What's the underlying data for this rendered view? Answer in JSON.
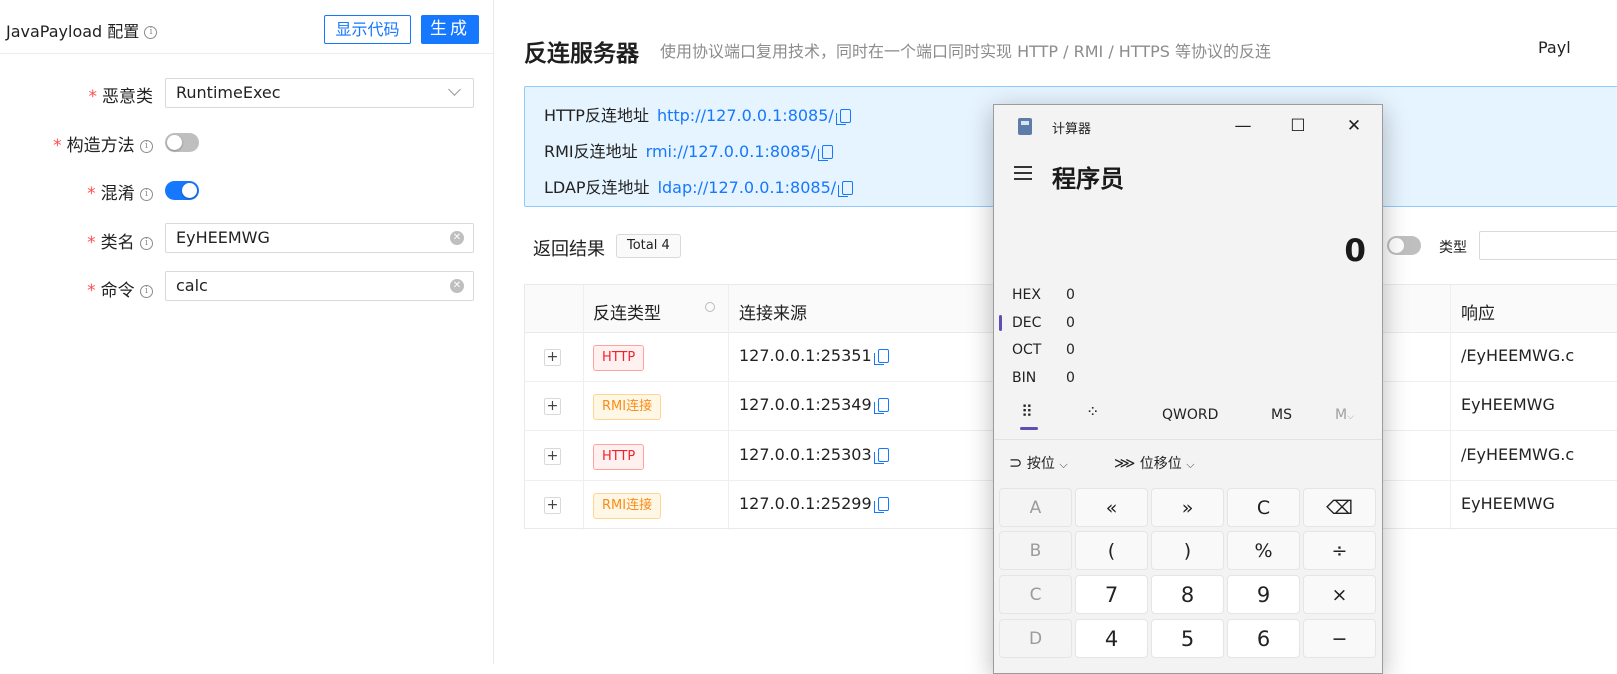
{
  "left_panel": {
    "title": "JavaPayload 配置",
    "btn_show_code": "显示代码",
    "btn_generate": "生成",
    "fields": {
      "malicious_class": {
        "label": "恶意类",
        "value": "RuntimeExec"
      },
      "constructor": {
        "label": "构造方法",
        "on": false
      },
      "obfuscate": {
        "label": "混淆",
        "on": true
      },
      "class_name": {
        "label": "类名",
        "value": "EyHEEMWG"
      },
      "command": {
        "label": "命令",
        "value": "calc"
      }
    }
  },
  "main": {
    "title": "反连服务器",
    "desc": "使用协议端口复用技术，同时在一个端口同时实现 HTTP / RMI / HTTPS 等协议的反连",
    "top_right": "Payl"
  },
  "alert": {
    "http_label": "HTTP反连地址",
    "http_url": "http://127.0.0.1:8085/",
    "rmi_label": "RMI反连地址",
    "rmi_url": "rmi://127.0.0.1:8085/",
    "ldap_label": "LDAP反连地址",
    "ldap_url": "ldap://127.0.0.1:8085/"
  },
  "results": {
    "title": "返回结果",
    "total": "Total 4",
    "type_label": "类型",
    "columns": {
      "type": "反连类型",
      "source": "连接来源",
      "response": "响应"
    },
    "rows": [
      {
        "type": "HTTP",
        "source": "127.0.0.1:25351",
        "response": "/EyHEEMWG.c"
      },
      {
        "type": "RMI连接",
        "source": "127.0.0.1:25349",
        "response": "EyHEEMWG"
      },
      {
        "type": "HTTP",
        "source": "127.0.0.1:25303",
        "response": "/EyHEEMWG.c"
      },
      {
        "type": "RMI连接",
        "source": "127.0.0.1:25299",
        "response": "EyHEEMWG"
      }
    ]
  },
  "calculator": {
    "window_title": "计算器",
    "mode": "程序员",
    "display": "0",
    "hex_label": "HEX",
    "hex_value": "0",
    "dec_label": "DEC",
    "dec_value": "0",
    "oct_label": "OCT",
    "oct_value": "0",
    "bin_label": "BIN",
    "bin_value": "0",
    "word_size": "QWORD",
    "ms": "MS",
    "mlist": "M",
    "bitwise": "按位",
    "bitshift": "位移位",
    "keys": {
      "a": "A",
      "lshift": "«",
      "rshift": "»",
      "clear": "C",
      "backspace": "⌫",
      "b": "B",
      "lparen": "(",
      "rparen": ")",
      "percent": "%",
      "divide": "÷",
      "c": "C",
      "seven": "7",
      "eight": "8",
      "nine": "9",
      "multiply": "×",
      "d": "D",
      "four": "4",
      "five": "5",
      "six": "6",
      "minus": "−"
    }
  }
}
